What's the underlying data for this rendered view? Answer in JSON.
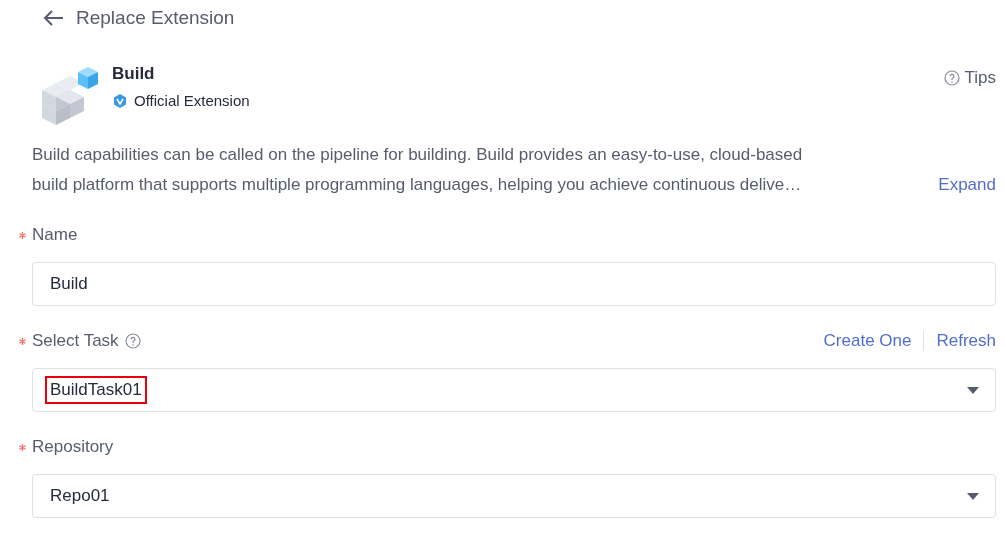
{
  "header": {
    "title": "Replace Extension"
  },
  "extension": {
    "name": "Build",
    "badge": "Official Extension",
    "tips": "Tips"
  },
  "description": {
    "lines": [
      "Build capabilities can be called on the pipeline for building. Build provides an easy-to-use, cloud-based",
      "build platform that supports multiple programming languages, helping you achieve continuous delive…"
    ],
    "expand": "Expand"
  },
  "fields": [
    {
      "kind": "input",
      "label": "Name",
      "required": true,
      "help": false,
      "value": "Build",
      "highlighted": false
    },
    {
      "kind": "select",
      "label": "Select Task",
      "required": true,
      "help": true,
      "value": "BuildTask01",
      "highlighted": true,
      "links": [
        "Create One",
        "Refresh"
      ]
    },
    {
      "kind": "select",
      "label": "Repository",
      "required": true,
      "help": false,
      "value": "Repo01",
      "highlighted": false
    }
  ]
}
